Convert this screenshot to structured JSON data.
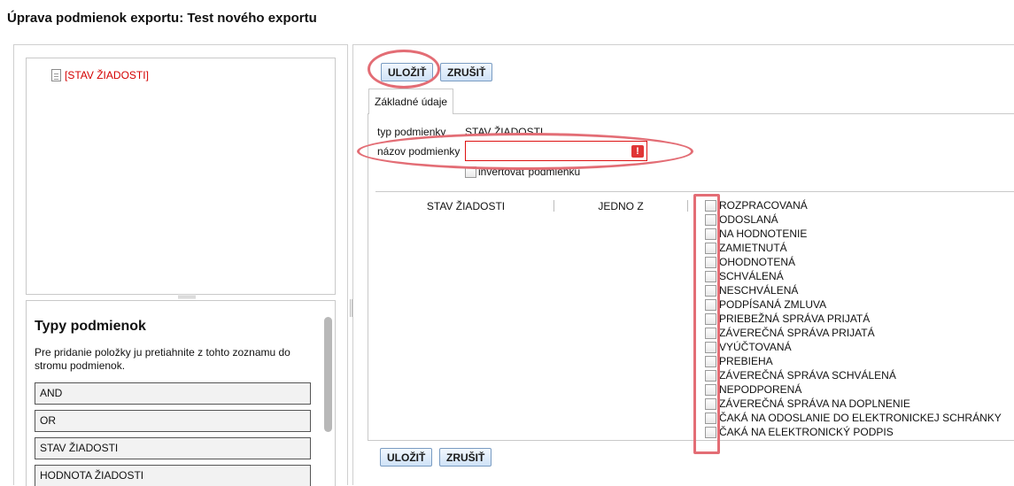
{
  "title": "Úprava podmienok exportu: Test nového exportu",
  "tree": {
    "node_label": "[STAV ŽIADOSTI]"
  },
  "types": {
    "title": "Typy podmienok",
    "description": "Pre pridanie položky ju pretiahnite z tohto zoznamu do stromu podmienok.",
    "items": [
      "AND",
      "OR",
      "STAV ŽIADOSTI",
      "HODNOTA ŽIADOSTI"
    ]
  },
  "toolbar": {
    "save_label": "ULOŽIŤ",
    "cancel_label": "ZRUŠIŤ"
  },
  "tab": {
    "label": "Základné údaje"
  },
  "form": {
    "type_label": "typ podmienky",
    "type_value": "STAV ŽIADOSTI",
    "name_label": "názov podmienky",
    "name_value": "",
    "error_icon": "!",
    "invert_label": "invertovať podmienku",
    "invert_checked": false
  },
  "condition": {
    "column1": "STAV ŽIADOSTI",
    "column2": "JEDNO Z",
    "options": [
      "ROZPRACOVANÁ",
      "ODOSLANÁ",
      "NA HODNOTENIE",
      "ZAMIETNUTÁ",
      "OHODNOTENÁ",
      "SCHVÁLENÁ",
      "NESCHVÁLENÁ",
      "PODPÍSANÁ ZMLUVA",
      "PRIEBEŽNÁ SPRÁVA PRIJATÁ",
      "ZÁVEREČNÁ SPRÁVA PRIJATÁ",
      "VYÚČTOVANÁ",
      "PREBIEHA",
      "ZÁVEREČNÁ SPRÁVA SCHVÁLENÁ",
      "NEPODPORENÁ",
      "ZÁVEREČNÁ SPRÁVA NA DOPLNENIE",
      "ČAKÁ NA ODOSLANIE DO ELEKTRONICKEJ SCHRÁNKY",
      "ČAKÁ NA ELEKTRONICKÝ PODPIS"
    ]
  },
  "colors": {
    "highlight": "#e36d75",
    "error": "#e03535",
    "button_border": "#7a9cc2"
  }
}
